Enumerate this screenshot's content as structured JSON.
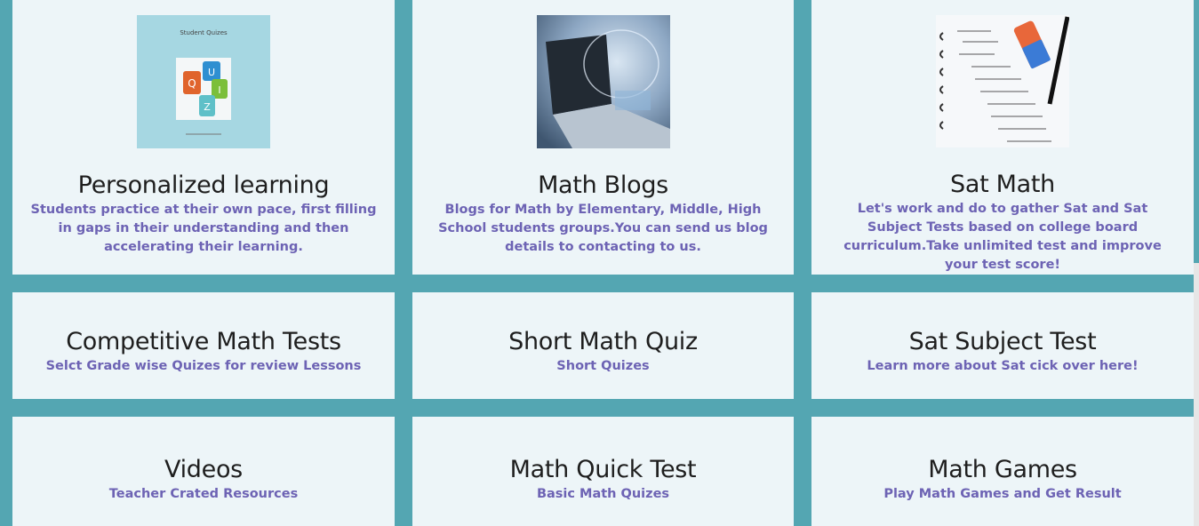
{
  "cards": [
    {
      "title": "Personalized learning",
      "desc": "Students practice at their own pace, first filling in gaps in their understanding and then accelerating their learning.",
      "image": "student-quizzes-thumbnail",
      "thumb_text": {
        "heading": "Student Quizes",
        "letters": [
          "Q",
          "U",
          "I",
          "Z"
        ]
      }
    },
    {
      "title": "Math Blogs",
      "desc": "Blogs for Math by Elementary, Middle, High School students groups.You can send us blog details to contacting to us.",
      "image": "laptop-math-blog-thumbnail"
    },
    {
      "title": "Sat Math",
      "desc": "Let's work and do to gather Sat and Sat Subject Tests based on college board curriculum.Take unlimited test and improve your test score!",
      "image": "notebook-equations-thumbnail"
    },
    {
      "title": "Competitive Math Tests",
      "desc": "Selct Grade wise Quizes for review Lessons"
    },
    {
      "title": "Short Math Quiz",
      "desc": "Short Quizes"
    },
    {
      "title": "Sat Subject Test",
      "desc": "Learn more about Sat cick over here!"
    },
    {
      "title": "Videos",
      "desc": "Teacher Crated Resources"
    },
    {
      "title": "Math Quick Test",
      "desc": "Basic Math Quizes"
    },
    {
      "title": "Math Games",
      "desc": "Play Math Games and Get Result"
    }
  ],
  "colors": {
    "background": "#54a6b2",
    "card": "#edf5f8",
    "title": "#1e1e1e",
    "desc": "#6d63b4"
  }
}
